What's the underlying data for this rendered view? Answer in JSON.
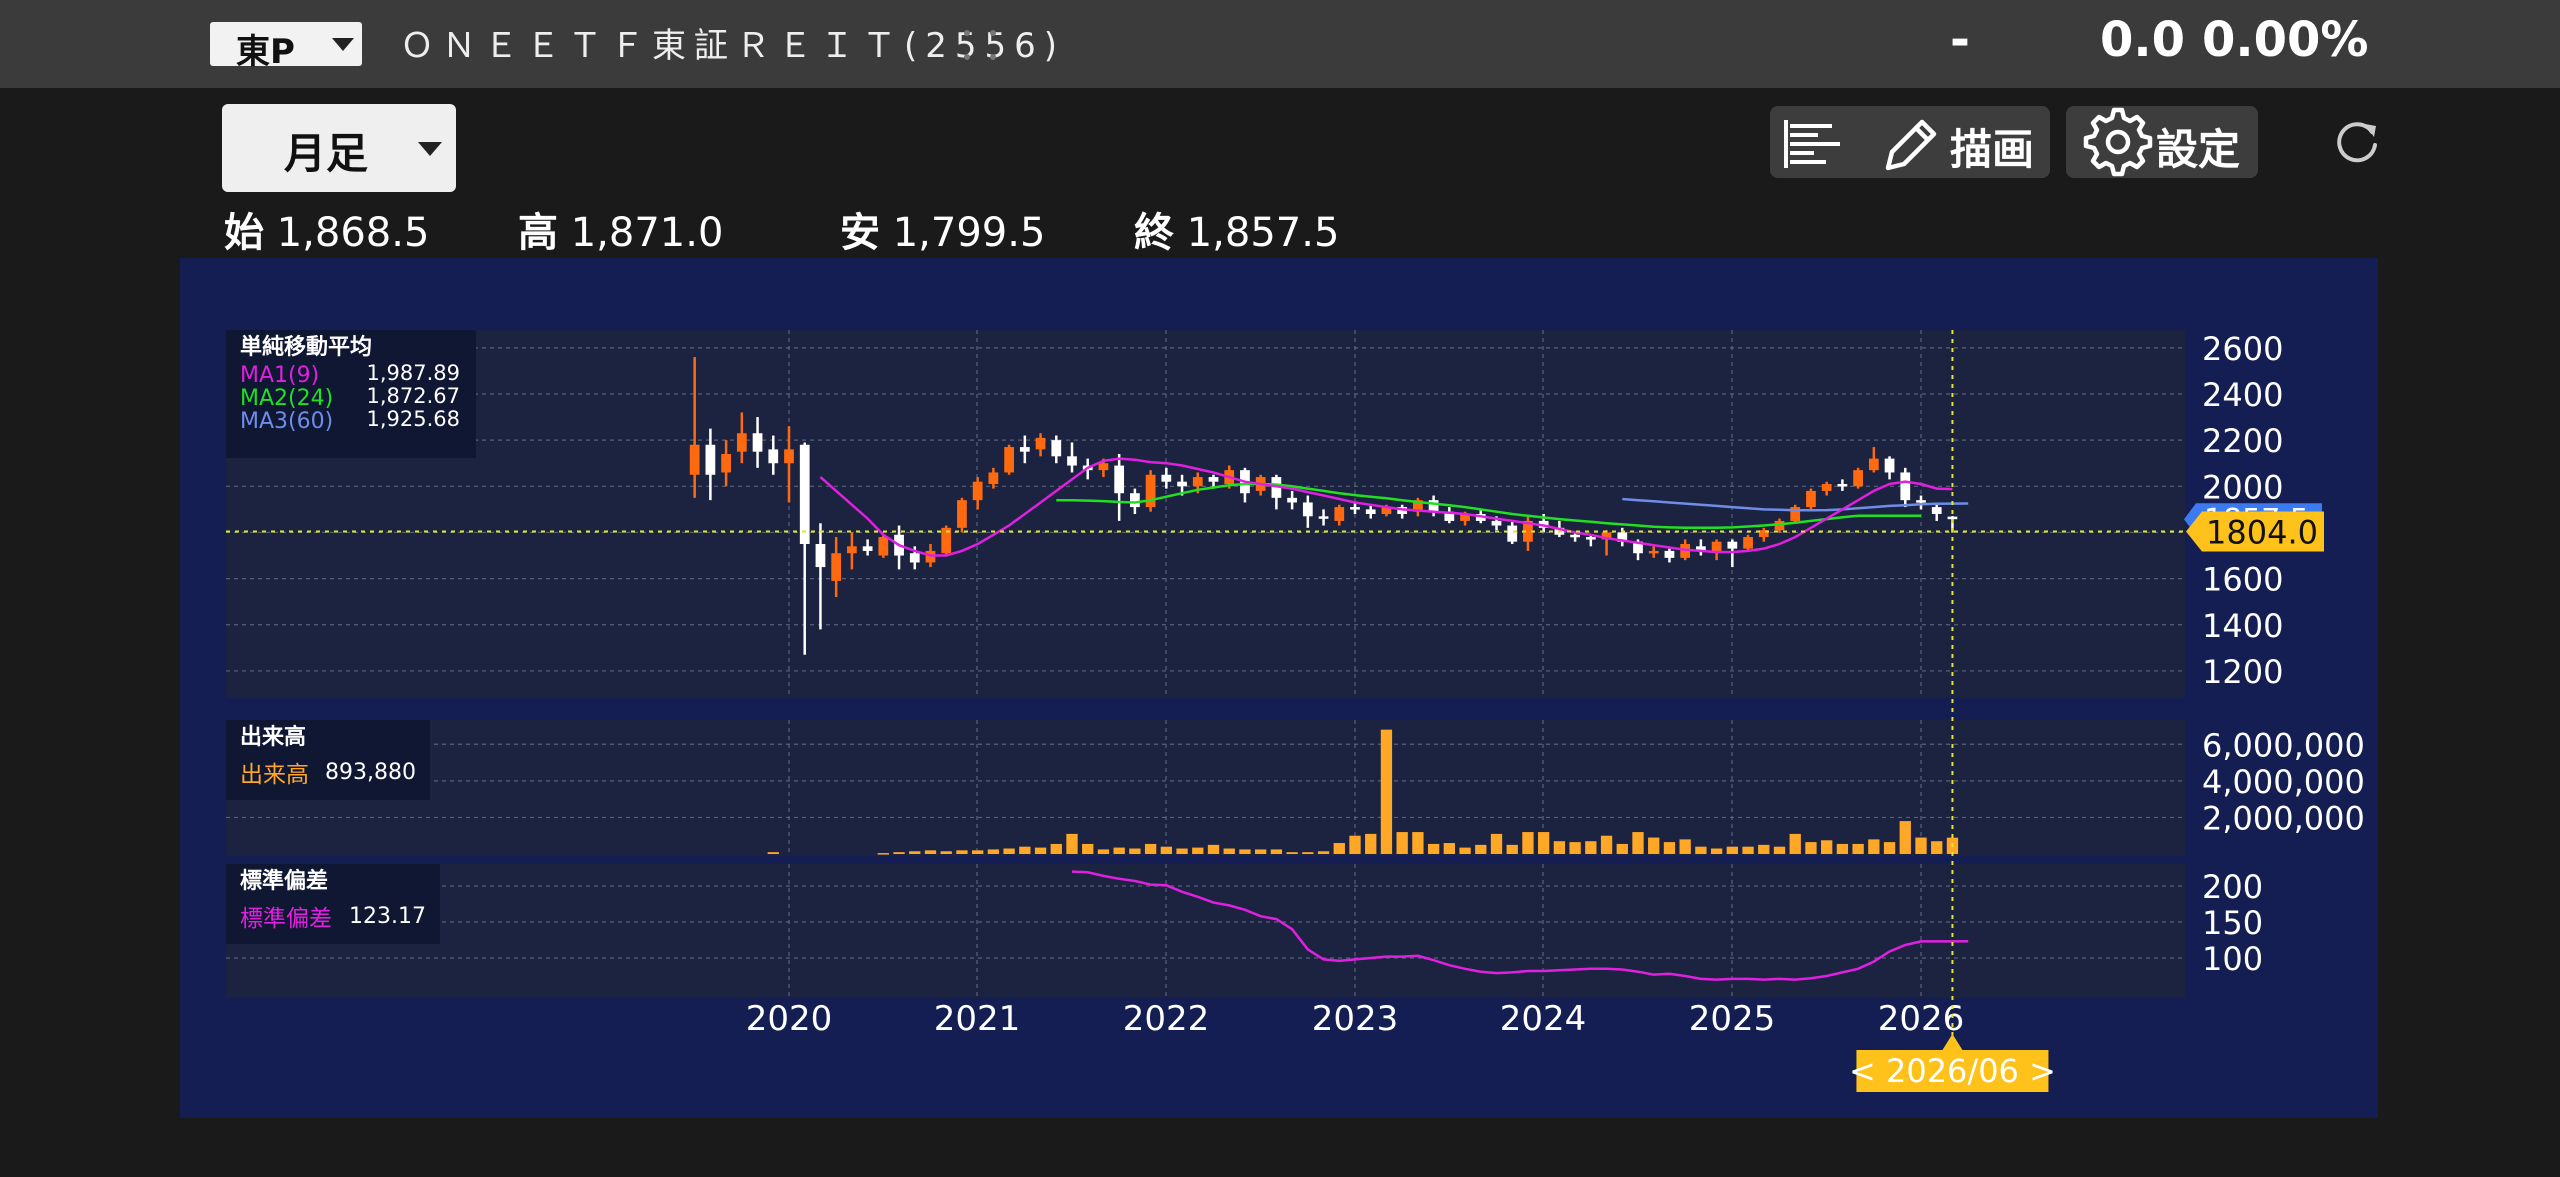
{
  "header": {
    "market": "東P",
    "security_name": "ＯＮＥＥＴＦ東証ＲＥＩＴ(2556)",
    "change": "-",
    "price": "0.0",
    "change_pct": "0.00%"
  },
  "toolbar": {
    "period": "月足",
    "draw_label": "描画",
    "settings_label": "設定"
  },
  "ohlc": {
    "open_label": "始",
    "open": "1,868.5",
    "high_label": "高",
    "high": "1,871.0",
    "low_label": "安",
    "low": "1,799.5",
    "close_label": "終",
    "close": "1,857.5"
  },
  "colors": {
    "background": "#1a1a1a",
    "panel": "#141e52",
    "plot": "#1b2340",
    "up_candle": "#ff6a10",
    "down_candle": "#ffffff",
    "ma1": "#e020e0",
    "ma2": "#20e020",
    "ma3": "#6f8de8",
    "volume": "#ffa726",
    "stddev": "#e020e0",
    "crosshair": "#e6e62a",
    "price_tag": "#ffc21a"
  },
  "chart_data": {
    "type": "candlestick",
    "period": "monthly",
    "x_tick_labels": [
      "2020",
      "2021",
      "2022",
      "2023",
      "2024",
      "2025",
      "2026"
    ],
    "cursor_label": "< 2026/06 >",
    "price_pane": {
      "legend_title": "単純移動平均",
      "legend": [
        {
          "name": "MA1(9)",
          "value": "1,987.89"
        },
        {
          "name": "MA2(24)",
          "value": "1,872.67"
        },
        {
          "name": "MA3(60)",
          "value": "1,925.68"
        }
      ],
      "y_ticks": [
        "2600",
        "2400",
        "2200",
        "2000",
        "1600",
        "1400",
        "1200"
      ],
      "ylim": [
        1100,
        2660
      ],
      "crosshair_value": "1804.0",
      "last_price_tag": "1857.5",
      "start_month": "2019-07",
      "candles": [
        [
          2050,
          2560,
          1950,
          2180
        ],
        [
          2180,
          2250,
          1940,
          2050
        ],
        [
          2060,
          2200,
          2000,
          2140
        ],
        [
          2150,
          2320,
          2100,
          2230
        ],
        [
          2230,
          2300,
          2080,
          2150
        ],
        [
          2160,
          2220,
          2050,
          2100
        ],
        [
          2100,
          2260,
          1930,
          2160
        ],
        [
          2180,
          2190,
          1270,
          1750
        ],
        [
          1750,
          1840,
          1380,
          1650
        ],
        [
          1590,
          1780,
          1520,
          1710
        ],
        [
          1710,
          1800,
          1640,
          1740
        ],
        [
          1740,
          1770,
          1700,
          1720
        ],
        [
          1700,
          1790,
          1690,
          1780
        ],
        [
          1790,
          1830,
          1640,
          1700
        ],
        [
          1710,
          1740,
          1640,
          1670
        ],
        [
          1670,
          1750,
          1650,
          1720
        ],
        [
          1710,
          1830,
          1700,
          1820
        ],
        [
          1820,
          1950,
          1800,
          1940
        ],
        [
          1940,
          2040,
          1900,
          2020
        ],
        [
          2010,
          2080,
          1990,
          2060
        ],
        [
          2060,
          2180,
          2050,
          2170
        ],
        [
          2170,
          2220,
          2100,
          2150
        ],
        [
          2160,
          2230,
          2130,
          2210
        ],
        [
          2200,
          2220,
          2100,
          2130
        ],
        [
          2130,
          2190,
          2060,
          2090
        ],
        [
          2090,
          2120,
          2030,
          2070
        ],
        [
          2070,
          2120,
          2040,
          2100
        ],
        [
          2090,
          2140,
          1850,
          1970
        ],
        [
          1970,
          1990,
          1880,
          1910
        ],
        [
          1910,
          2070,
          1890,
          2050
        ],
        [
          2050,
          2080,
          1990,
          2020
        ],
        [
          2020,
          2050,
          1960,
          2000
        ],
        [
          2000,
          2060,
          1970,
          2040
        ],
        [
          2040,
          2050,
          1990,
          2020
        ],
        [
          2010,
          2090,
          1990,
          2070
        ],
        [
          2070,
          2080,
          1930,
          1970
        ],
        [
          1980,
          2050,
          1960,
          2040
        ],
        [
          2040,
          2050,
          1900,
          1950
        ],
        [
          1950,
          1980,
          1900,
          1930
        ],
        [
          1930,
          1960,
          1820,
          1870
        ],
        [
          1870,
          1900,
          1830,
          1860
        ],
        [
          1850,
          1920,
          1830,
          1910
        ],
        [
          1910,
          1930,
          1880,
          1900
        ],
        [
          1900,
          1920,
          1860,
          1880
        ],
        [
          1880,
          1920,
          1870,
          1910
        ],
        [
          1910,
          1920,
          1860,
          1880
        ],
        [
          1890,
          1950,
          1870,
          1940
        ],
        [
          1940,
          1960,
          1870,
          1890
        ],
        [
          1890,
          1910,
          1840,
          1850
        ],
        [
          1850,
          1890,
          1830,
          1880
        ],
        [
          1880,
          1900,
          1840,
          1850
        ],
        [
          1850,
          1870,
          1810,
          1830
        ],
        [
          1830,
          1850,
          1750,
          1760
        ],
        [
          1760,
          1870,
          1720,
          1850
        ],
        [
          1850,
          1880,
          1800,
          1820
        ],
        [
          1820,
          1850,
          1780,
          1790
        ],
        [
          1790,
          1800,
          1760,
          1780
        ],
        [
          1780,
          1790,
          1740,
          1770
        ],
        [
          1770,
          1810,
          1700,
          1800
        ],
        [
          1800,
          1820,
          1740,
          1760
        ],
        [
          1760,
          1770,
          1680,
          1710
        ],
        [
          1710,
          1740,
          1690,
          1720
        ],
        [
          1720,
          1730,
          1670,
          1690
        ],
        [
          1690,
          1770,
          1680,
          1750
        ],
        [
          1740,
          1770,
          1700,
          1720
        ],
        [
          1720,
          1770,
          1680,
          1760
        ],
        [
          1760,
          1770,
          1650,
          1730
        ],
        [
          1730,
          1790,
          1720,
          1780
        ],
        [
          1780,
          1820,
          1760,
          1810
        ],
        [
          1810,
          1860,
          1800,
          1850
        ],
        [
          1850,
          1920,
          1840,
          1910
        ],
        [
          1910,
          1990,
          1900,
          1980
        ],
        [
          1980,
          2020,
          1960,
          2010
        ],
        [
          2010,
          2030,
          1980,
          2000
        ],
        [
          2000,
          2080,
          1990,
          2070
        ],
        [
          2070,
          2170,
          2060,
          2120
        ],
        [
          2120,
          2130,
          2030,
          2060
        ],
        [
          2060,
          2080,
          1910,
          1940
        ],
        [
          1940,
          1960,
          1900,
          1930
        ],
        [
          1910,
          1920,
          1850,
          1880
        ],
        [
          1868.5,
          1871.0,
          1799.5,
          1857.5
        ]
      ],
      "ma1_start_index": 8,
      "ma1": [
        2040,
        1980,
        1920,
        1860,
        1790,
        1745,
        1720,
        1700,
        1700,
        1720,
        1750,
        1790,
        1830,
        1880,
        1930,
        1980,
        2030,
        2080,
        2110,
        2120,
        2115,
        2105,
        2100,
        2090,
        2075,
        2060,
        2040,
        2020,
        2010,
        2000,
        1990,
        1975,
        1960,
        1945,
        1930,
        1920,
        1910,
        1900,
        1895,
        1890,
        1885,
        1880,
        1870,
        1860,
        1850,
        1840,
        1830,
        1815,
        1800,
        1790,
        1775,
        1765,
        1755,
        1745,
        1735,
        1725,
        1720,
        1715,
        1715,
        1720,
        1730,
        1750,
        1780,
        1820,
        1860,
        1900,
        1940,
        1980,
        2010,
        2020,
        2010,
        1990,
        1987.89
      ],
      "ma2_start_index": 23,
      "ma2": [
        1940,
        1940,
        1938,
        1936,
        1932,
        1930,
        1940,
        1955,
        1970,
        1985,
        1995,
        2005,
        2010,
        2010,
        2008,
        2000,
        1990,
        1980,
        1970,
        1962,
        1955,
        1948,
        1940,
        1932,
        1925,
        1918,
        1910,
        1900,
        1890,
        1880,
        1872,
        1865,
        1858,
        1852,
        1846,
        1840,
        1835,
        1830,
        1825,
        1822,
        1820,
        1820,
        1820,
        1822,
        1826,
        1830,
        1836,
        1842,
        1850,
        1858,
        1866,
        1872,
        1872,
        1872,
        1872,
        1872.67
      ],
      "ma3_start_index": 59,
      "ma3": [
        1945,
        1940,
        1935,
        1930,
        1925,
        1920,
        1915,
        1910,
        1905,
        1900,
        1898,
        1896,
        1896,
        1897,
        1900,
        1905,
        1910,
        1915,
        1918,
        1922,
        1924,
        1925,
        1925.68
      ]
    },
    "volume_pane": {
      "title": "出来高",
      "legend": [
        {
          "name": "出来高",
          "value": "893,880"
        }
      ],
      "y_ticks": [
        "6,000,000",
        "4,000,000",
        "2,000,000"
      ],
      "ylim": [
        0,
        7000000
      ],
      "values": [
        0,
        0,
        0,
        0,
        0,
        100000,
        0,
        0,
        0,
        0,
        0,
        0,
        50000,
        100000,
        150000,
        200000,
        150000,
        200000,
        200000,
        250000,
        300000,
        400000,
        350000,
        550000,
        1100000,
        550000,
        250000,
        350000,
        300000,
        550000,
        400000,
        300000,
        350000,
        500000,
        300000,
        250000,
        250000,
        250000,
        100000,
        100000,
        150000,
        600000,
        1000000,
        1100000,
        6800000,
        1200000,
        1200000,
        550000,
        600000,
        350000,
        500000,
        1100000,
        500000,
        1200000,
        1200000,
        700000,
        650000,
        700000,
        1000000,
        550000,
        1200000,
        900000,
        650000,
        800000,
        400000,
        300000,
        400000,
        400000,
        500000,
        400000,
        1100000,
        650000,
        750000,
        550000,
        550000,
        800000,
        650000,
        1800000,
        900000,
        700000,
        893880
      ]
    },
    "stddev_pane": {
      "title": "標準偏差",
      "legend": [
        {
          "name": "標準偏差",
          "value": "123.17"
        }
      ],
      "y_ticks": [
        "200",
        "150",
        "100"
      ],
      "ylim": [
        50,
        225
      ],
      "start_index": 24,
      "values": [
        220,
        219,
        214,
        210,
        207,
        202,
        201,
        192,
        185,
        177,
        173,
        167,
        158,
        154,
        140,
        112,
        98,
        96,
        98,
        100,
        102,
        102,
        103,
        97,
        90,
        85,
        81,
        79,
        80,
        82,
        82,
        83,
        84,
        85,
        85,
        84,
        81,
        77,
        78,
        75,
        71,
        70,
        71,
        71,
        70,
        71,
        70,
        72,
        75,
        80,
        85,
        95,
        109,
        118,
        123,
        123,
        123,
        123.17
      ]
    }
  }
}
